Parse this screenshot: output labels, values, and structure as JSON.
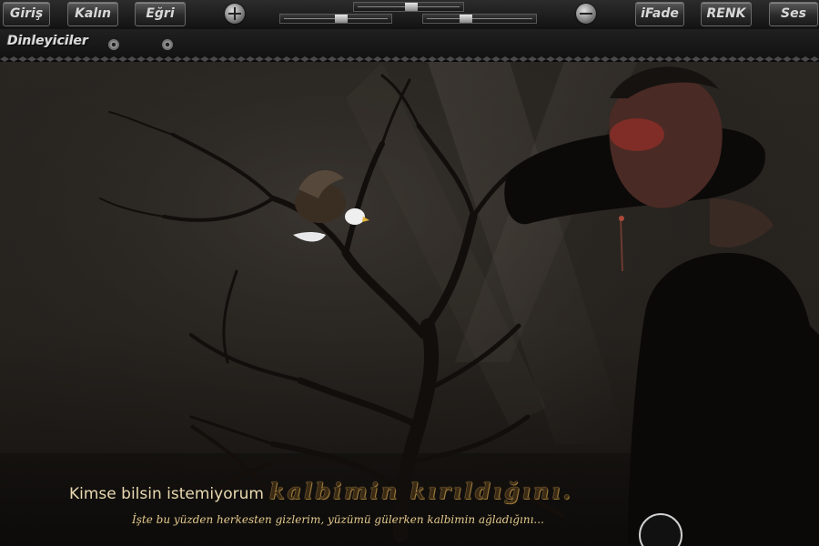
{
  "toolbar": {
    "giris": "Giriş",
    "kalin": "Kalın",
    "egri": "Eğri",
    "ifade": "iFade",
    "renk": "RENK",
    "ses": "Ses"
  },
  "listeners": {
    "label": "Dinleyiciler"
  },
  "caption": {
    "plain": "Kimse bilsin istemiyorum",
    "script": "kalbimin kırıldığını.",
    "sub": "İşte bu yüzden herkesten gizlerim, yüzümü gülerken kalbimin ağladığını..."
  },
  "icons": {
    "zoom_in": "plus-icon",
    "zoom_out": "minus-icon"
  },
  "colors": {
    "caption_plain": "#e8d9b0",
    "caption_script_glow": "#c9a15a",
    "subcaption": "#e3c98d",
    "toolbar_bg": "#1a1a1a"
  }
}
